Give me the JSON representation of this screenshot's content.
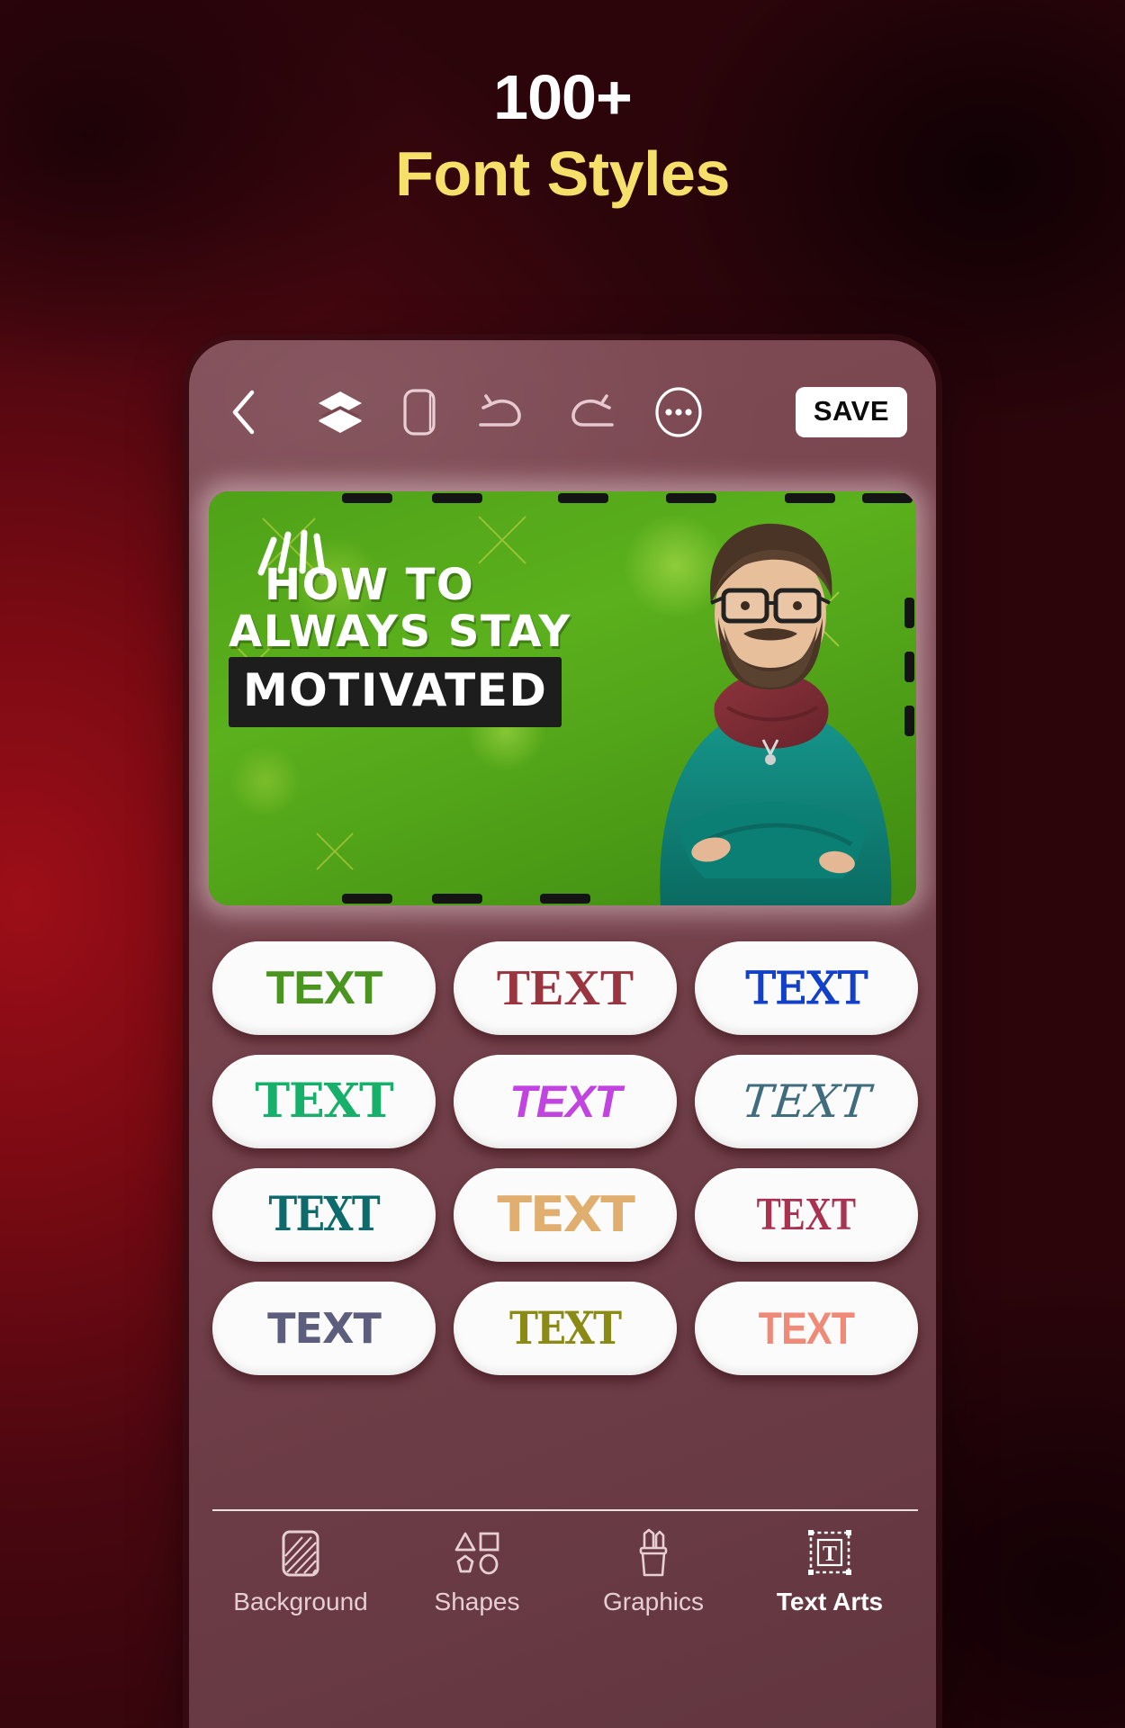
{
  "headline": {
    "line1": "100+",
    "line2": "Font Styles",
    "line1_color": "#ffffff",
    "line2_color": "#f7e06a"
  },
  "theme": {
    "background_red": "#7a0a13",
    "background_dark": "#2c050b",
    "phone_frame": "#79454f",
    "accent_yellow": "#f7e06a"
  },
  "toolbar": {
    "back_icon": "chevron-left-icon",
    "layers_icon": "layers-icon",
    "canvas_icon": "canvas-frame-icon",
    "undo_icon": "undo-arrow-icon",
    "redo_icon": "redo-arrow-icon",
    "more_icon": "more-ellipsis-circle-icon",
    "save_label": "SAVE"
  },
  "canvas": {
    "line1": "HOW TO",
    "line2": "ALWAYS STAY",
    "line3": "MOTIVATED",
    "background_color": "#4fa218",
    "highlight_color": "#1d1d1d",
    "text_color": "#ffffff",
    "photo_description": "bearded man with glasses, teal sweater, maroon scarf, arms crossed",
    "sweater_color": "#0f7d72",
    "scarf_color": "#7d2c33"
  },
  "font_styles": {
    "label": "TEXT",
    "items": [
      {
        "label": "TEXT",
        "color": "#4a9420",
        "style_class": "fs-1",
        "name": "font-style-1"
      },
      {
        "label": "TEXT",
        "color": "#9a3540",
        "style_class": "fs-2",
        "name": "font-style-2"
      },
      {
        "label": "TEXT",
        "color": "#1340c8",
        "style_class": "fs-3",
        "name": "font-style-3"
      },
      {
        "label": "TEXT",
        "color": "#16b06a",
        "style_class": "fs-4",
        "name": "font-style-4"
      },
      {
        "label": "TEXT",
        "color": "#c244e0",
        "style_class": "fs-5",
        "name": "font-style-5"
      },
      {
        "label": "TEXT",
        "color": "#3f6d7d",
        "style_class": "fs-6",
        "name": "font-style-6"
      },
      {
        "label": "TEXT",
        "color": "#0e6b6b",
        "style_class": "fs-7",
        "name": "font-style-7"
      },
      {
        "label": "TEXT",
        "color": "#e0ae6e",
        "style_class": "fs-8",
        "name": "font-style-8"
      },
      {
        "label": "TEXT",
        "color": "#a8324f",
        "style_class": "fs-9",
        "name": "font-style-9"
      },
      {
        "label": "TEXT",
        "color": "#5d5d7e",
        "style_class": "fs-10",
        "name": "font-style-10"
      },
      {
        "label": "TEXT",
        "color": "#8a8a14",
        "style_class": "fs-11",
        "name": "font-style-11"
      },
      {
        "label": "TEXT",
        "color": "#f08a78",
        "style_class": "fs-12",
        "name": "font-style-12"
      }
    ]
  },
  "bottom_nav": {
    "items": [
      {
        "label": "Background",
        "icon": "background-hatch-icon",
        "active": false
      },
      {
        "label": "Shapes",
        "icon": "shapes-icon",
        "active": false
      },
      {
        "label": "Graphics",
        "icon": "pencil-cup-icon",
        "active": false
      },
      {
        "label": "Text Arts",
        "icon": "text-box-icon",
        "active": true
      }
    ]
  }
}
